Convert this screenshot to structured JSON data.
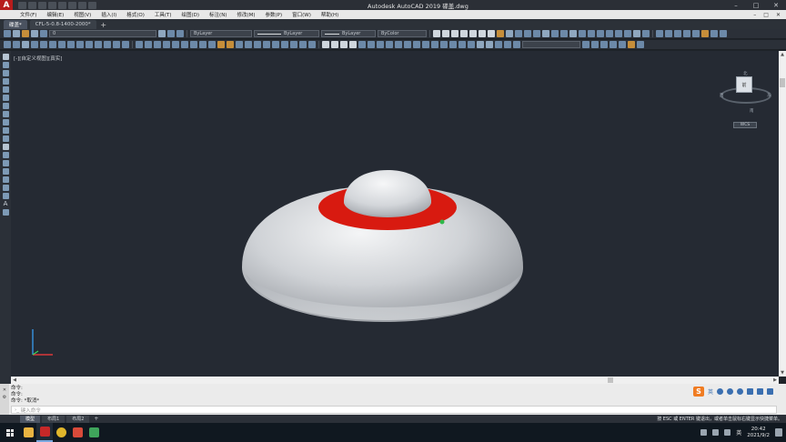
{
  "window": {
    "title": "Autodesk AutoCAD 2019    碟盖.dwg",
    "logo": "A",
    "minimize": "–",
    "maximize": "□",
    "close": "✕"
  },
  "menu": {
    "items": [
      "文件(F)",
      "编辑(E)",
      "视图(V)",
      "插入(I)",
      "格式(O)",
      "工具(T)",
      "绘图(D)",
      "标注(N)",
      "修改(M)",
      "参数(P)",
      "窗口(W)",
      "帮助(H)"
    ],
    "right_minimize": "–",
    "right_restore": "□",
    "right_close": "✕"
  },
  "file_tabs": [
    {
      "label": "碟盖*",
      "active": true
    },
    {
      "label": "CFL-5-0.8-1400-2000*",
      "active": false
    }
  ],
  "tab_add": "+",
  "toolbar1": {
    "layer_value": "0",
    "color_value": "ByLayer",
    "linetype_value": "ByLayer",
    "lineweight_value": "ByLayer",
    "plotstyle_value": "ByColor"
  },
  "left_toolbar": {
    "text_tool": "A"
  },
  "viewport": {
    "label": "[-][自定义视图][真实]",
    "colors": {
      "background": "#252a33",
      "dome": "#cfd2d6",
      "ring": "#d81a10"
    }
  },
  "viewcube": {
    "face": "前",
    "north": "北",
    "west": "西",
    "east": "东",
    "south": "南",
    "wcs": "WCS"
  },
  "ucs_icon": {
    "x_label": "X",
    "y_label": "Y"
  },
  "command": {
    "history": [
      "命令:",
      "命令:",
      "命令: *取消*"
    ],
    "input_placeholder": "键入命令"
  },
  "ime": {
    "logo": "S",
    "lang": "英"
  },
  "layout_tabs": [
    {
      "label": "模型",
      "active": true
    },
    {
      "label": "布局1",
      "active": false
    },
    {
      "label": "布局2",
      "active": false
    }
  ],
  "layout_add": "+",
  "status_hint": "按 ESC 或 ENTER 键退出，或者单击鼠标右键显示快捷菜单。",
  "taskbar": {
    "time": "20:42",
    "date": "2021/9/2",
    "ime": "英"
  }
}
